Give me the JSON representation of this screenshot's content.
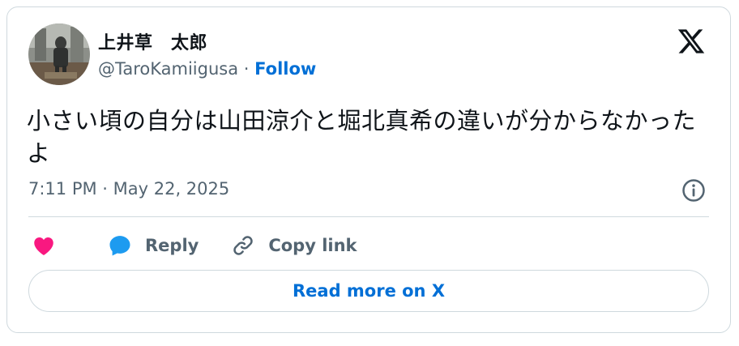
{
  "author": {
    "display_name": "上井草　太郎",
    "handle": "@TaroKamiigusa",
    "separator": "·",
    "follow_label": "Follow"
  },
  "tweet": {
    "text": "小さい頃の自分は山田涼介と堀北真希の違いが分からなかったよ",
    "timestamp": "7:11 PM · May 22, 2025"
  },
  "actions": {
    "like_icon": "heart-icon",
    "reply_label": "Reply",
    "copy_link_label": "Copy link"
  },
  "read_more_label": "Read more on X",
  "colors": {
    "link_blue": "#006fd6",
    "heart_pink": "#f91880",
    "reply_blue": "#1d9bf0",
    "text_primary": "#0f1419",
    "text_secondary": "#536471",
    "border": "#cfd9de"
  }
}
